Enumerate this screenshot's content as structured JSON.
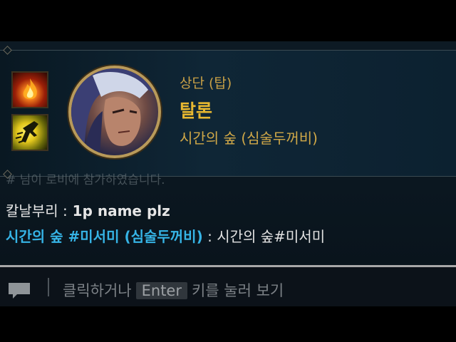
{
  "hover_card": {
    "role": "상단 (탑)",
    "champion": "탈론",
    "summoner": "시간의 숲 (심술두꺼비)"
  },
  "spells": [
    {
      "name": "ignite-spell-icon"
    },
    {
      "name": "ghost-spell-icon"
    }
  ],
  "chat": {
    "faded_line": "# 님이 로비에 참가하였습니다.",
    "messages": [
      {
        "sender": "칼날부리 :",
        "text": " 1p name plz"
      },
      {
        "sender": "시간의 숲 #미서미 (심술두꺼비)",
        "text": " : 시간의 숲#미서미"
      }
    ]
  },
  "input": {
    "hint_before": "클릭하거나",
    "key": "Enter",
    "hint_after": "키를 눌러 보기"
  },
  "colors": {
    "gold": "#c8a046",
    "champion_gold": "#e8b830",
    "sender_blue": "#36b4e6"
  }
}
